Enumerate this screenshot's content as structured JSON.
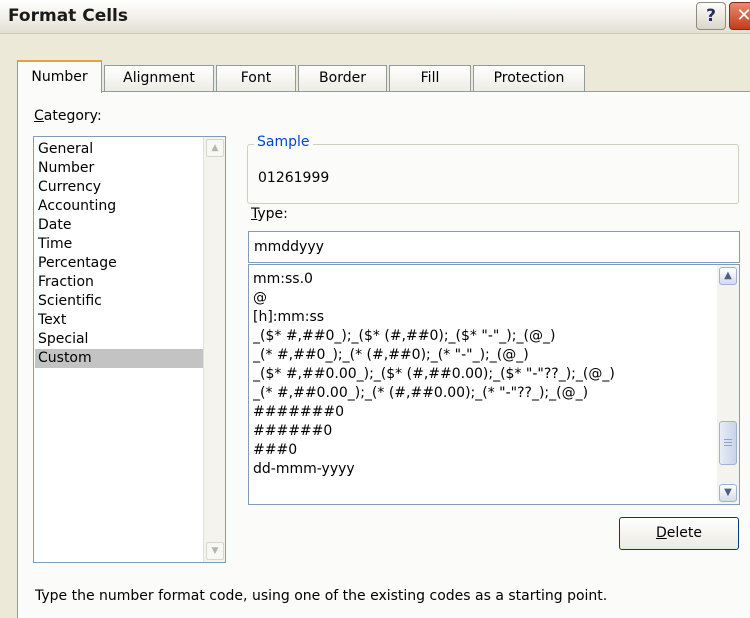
{
  "dialog": {
    "title": "Format Cells",
    "help_label": "?",
    "close_label": "✕"
  },
  "tabs": [
    {
      "label": "Number",
      "active": true
    },
    {
      "label": "Alignment",
      "active": false
    },
    {
      "label": "Font",
      "active": false
    },
    {
      "label": "Border",
      "active": false
    },
    {
      "label": "Fill",
      "active": false
    },
    {
      "label": "Protection",
      "active": false
    }
  ],
  "category": {
    "label_first": "C",
    "label_rest": "ategory:",
    "items": [
      "General",
      "Number",
      "Currency",
      "Accounting",
      "Date",
      "Time",
      "Percentage",
      "Fraction",
      "Scientific",
      "Text",
      "Special",
      "Custom"
    ],
    "selected": "Custom"
  },
  "sample": {
    "legend": "Sample",
    "value": "01261999"
  },
  "type": {
    "label_first": "T",
    "label_rest": "ype:",
    "value": "mmddyyy"
  },
  "format_codes": [
    "mm:ss.0",
    "@",
    "[h]:mm:ss",
    "_($* #,##0_);_($* (#,##0);_($* \"-\"_);_(@_)",
    "_(* #,##0_);_(* (#,##0);_(* \"-\"_);_(@_)",
    "_($* #,##0.00_);_($* (#,##0.00);_($* \"-\"??_);_(@_)",
    "_(* #,##0.00_);_(* (#,##0.00);_(* \"-\"??_);_(@_)",
    "#######0",
    "######0",
    "###0",
    "dd-mmm-yyyy"
  ],
  "delete_button": {
    "label_first": "D",
    "label_rest": "elete"
  },
  "hint": "Type the number format code, using one of the existing codes as a starting point.",
  "icons": {
    "scroll_up": "▲",
    "scroll_down": "▼"
  }
}
